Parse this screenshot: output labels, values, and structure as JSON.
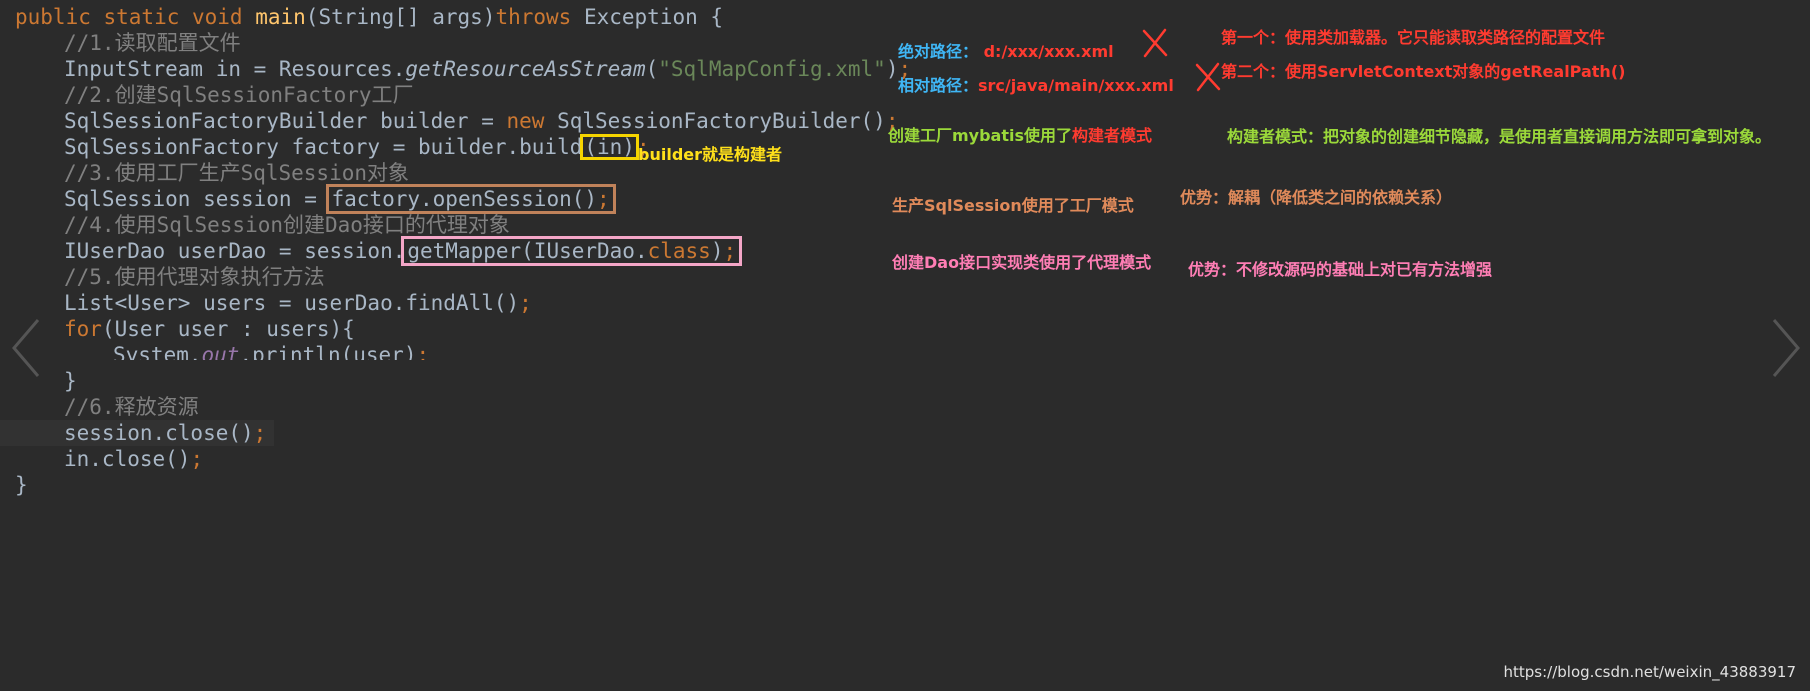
{
  "code": {
    "l1_kw": "public static void ",
    "l1_fn": "main",
    "l1_a": "(String[] args)",
    "l1_kw2": "throws ",
    "l1_b": "Exception {",
    "l2": "//1.读取配置文件",
    "l3_a": "InputStream in = Resources.",
    "l3_method": "getResourceAsStream",
    "l3_b": "(",
    "l3_str": "\"SqlMapConfig.xml\"",
    "l3_c": ")",
    "semi": ";",
    "l4": "//2.创建SqlSessionFactory工厂",
    "l5_a": "SqlSessionFactoryBuilder builder = ",
    "l5_new": "new ",
    "l5_b": "SqlSessionFactoryBuilder()",
    "l6_a": "SqlSessionFactory factory = builder.build",
    "l6_box": "(in)",
    "l7": "//3.使用工厂生产SqlSession对象",
    "l8_a": "SqlSession session = ",
    "l8_box": "factory.openSession()",
    "l9": "//4.使用SqlSession创建Dao接口的代理对象",
    "l10_a": "IUserDao userDao = session.",
    "l10_box_a": "getMapper(IUserDao.",
    "l10_box_kw": "class",
    "l10_box_b": ")",
    "l11": "//5.使用代理对象执行方法",
    "l12": "List<User> users = userDao.findAll()",
    "l13_kw": "for",
    "l13_b": "(User user : users){",
    "l14_a": "System.",
    "l14_fld": "out",
    "l14_b": ".println(user)",
    "l15": "}",
    "l16": "//6.释放资源",
    "l17": "session.close()",
    "l18": "in.close()",
    "l19": "}"
  },
  "annotations": {
    "builder_note": "builder就是构建者",
    "abs_label": "绝对路径：",
    "abs_path": "d:/xxx/xxx.xml",
    "rel_label": "相对路径：",
    "rel_path": "src/java/main/xxx.xml",
    "first": "第一个：使用类加载器。它只能读取类路径的配置文件",
    "second": "第二个：使用ServletContext对象的getRealPath()",
    "builder_pattern_a": "创建工厂mybatis使用了",
    "builder_pattern_b": "构建者模式",
    "builder_desc": "构建者模式：把对象的创建细节隐藏，是使用者直接调用方法即可拿到对象。",
    "factory_pattern": "生产SqlSession使用了工厂模式",
    "factory_adv": "优势：解耦（降低类之间的依赖关系）",
    "proxy_pattern": "创建Dao接口实现类使用了代理模式",
    "proxy_adv": "优势：不修改源码的基础上对已有方法增强"
  },
  "watermark": "https://blog.csdn.net/weixin_43883917",
  "icons": {
    "cross": "x-cross-icon",
    "prev": "chevron-left-icon",
    "next": "chevron-right-icon"
  },
  "colors": {
    "background": "#2b2b2b",
    "keyword": "#cc7832",
    "string": "#6a8759",
    "comment": "#808080",
    "method": "#ffc66d"
  }
}
